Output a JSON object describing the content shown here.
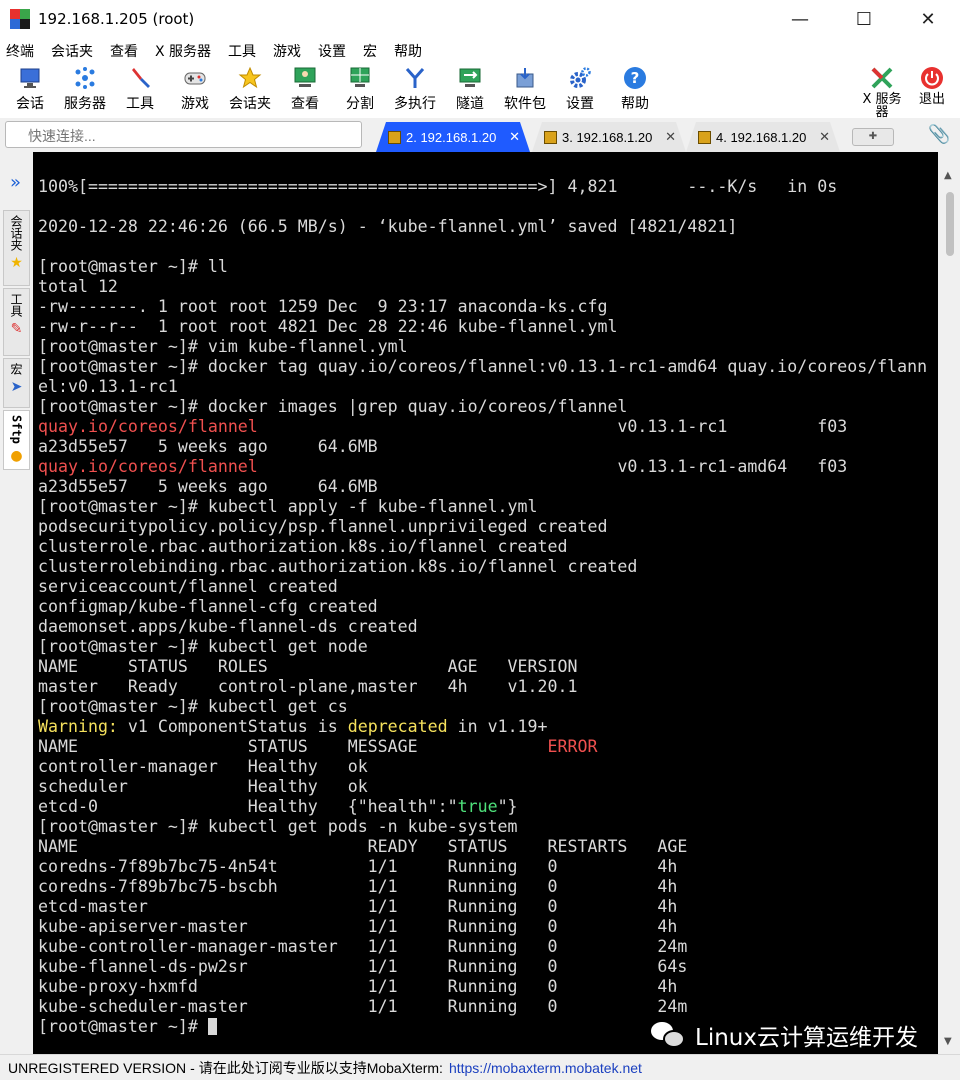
{
  "window": {
    "title": "192.168.1.205 (root)",
    "controls": {
      "minimize": "—",
      "maximize": "☐",
      "close": "✕"
    }
  },
  "menu": [
    "终端",
    "会话夹",
    "查看",
    "X 服务器",
    "工具",
    "游戏",
    "设置",
    "宏",
    "帮助"
  ],
  "toolbar": {
    "items": [
      {
        "label": "会话",
        "icon": "session-icon"
      },
      {
        "label": "服务器",
        "icon": "servers-icon"
      },
      {
        "label": "工具",
        "icon": "tools-icon"
      },
      {
        "label": "游戏",
        "icon": "games-icon"
      },
      {
        "label": "会话夹",
        "icon": "star-icon"
      },
      {
        "label": "查看",
        "icon": "view-icon"
      },
      {
        "label": "分割",
        "icon": "split-icon"
      },
      {
        "label": "多执行",
        "icon": "multiexec-icon"
      },
      {
        "label": "隧道",
        "icon": "tunnel-icon"
      },
      {
        "label": "软件包",
        "icon": "packages-icon"
      },
      {
        "label": "设置",
        "icon": "gear-icon"
      },
      {
        "label": "帮助",
        "icon": "help-icon"
      }
    ],
    "xserver_label": "X 服务器",
    "exit_label": "退出"
  },
  "quick_connect": {
    "placeholder": "快速连接..."
  },
  "tabs": [
    {
      "label": "2. 192.168.1.20",
      "active": true
    },
    {
      "label": "3. 192.168.1.20",
      "active": false
    },
    {
      "label": "4. 192.168.1.20",
      "active": false
    }
  ],
  "sidebar": {
    "tabs": [
      {
        "label": "会话夹",
        "icon": "star-icon"
      },
      {
        "label": "工具",
        "icon": "tools-icon"
      },
      {
        "label": "宏",
        "icon": "macro-icon"
      },
      {
        "label": "Sftp",
        "icon": "sftp-icon"
      }
    ]
  },
  "terminal": {
    "lines": [
      [
        {
          "t": "100%[=============================================>] 4,821       --.-K/s   in 0s"
        }
      ],
      [
        {
          "t": ""
        }
      ],
      [
        {
          "t": "2020-12-28 22:46:26 (66.5 MB/s) - ‘kube-flannel.yml’ saved [4821/4821]"
        }
      ],
      [
        {
          "t": ""
        }
      ],
      [
        {
          "t": "[root@master ~]# ll"
        }
      ],
      [
        {
          "t": "total 12"
        }
      ],
      [
        {
          "t": "-rw-------. 1 root root 1259 Dec  9 23:17 anaconda-ks.cfg"
        }
      ],
      [
        {
          "t": "-rw-r--r--  1 root root 4821 Dec 28 22:46 kube-flannel.yml"
        }
      ],
      [
        {
          "t": "[root@master ~]# vim kube-flannel.yml"
        }
      ],
      [
        {
          "t": "[root@master ~]# docker tag quay.io/coreos/flannel:v0.13.1-rc1-amd64 quay.io/coreos/flann"
        }
      ],
      [
        {
          "t": "el:v0.13.1-rc1"
        }
      ],
      [
        {
          "t": "[root@master ~]# docker images |grep quay.io/coreos/flannel"
        }
      ],
      [
        {
          "t": "quay.io/coreos/flannel",
          "c": "red"
        },
        {
          "t": "                                    v0.13.1-rc1         f03"
        }
      ],
      [
        {
          "t": "a23d55e57   5 weeks ago     64.6MB"
        }
      ],
      [
        {
          "t": "quay.io/coreos/flannel",
          "c": "red"
        },
        {
          "t": "                                    v0.13.1-rc1-amd64   f03"
        }
      ],
      [
        {
          "t": "a23d55e57   5 weeks ago     64.6MB"
        }
      ],
      [
        {
          "t": "[root@master ~]# kubectl apply -f kube-flannel.yml"
        }
      ],
      [
        {
          "t": "podsecuritypolicy.policy/psp.flannel.unprivileged created"
        }
      ],
      [
        {
          "t": "clusterrole.rbac.authorization.k8s.io/flannel created"
        }
      ],
      [
        {
          "t": "clusterrolebinding.rbac.authorization.k8s.io/flannel created"
        }
      ],
      [
        {
          "t": "serviceaccount/flannel created"
        }
      ],
      [
        {
          "t": "configmap/kube-flannel-cfg created"
        }
      ],
      [
        {
          "t": "daemonset.apps/kube-flannel-ds created"
        }
      ],
      [
        {
          "t": "[root@master ~]# kubectl get node"
        }
      ],
      [
        {
          "t": "NAME     STATUS   ROLES                  AGE   VERSION"
        }
      ],
      [
        {
          "t": "master   Ready    control-plane,master   4h    v1.20.1"
        }
      ],
      [
        {
          "t": "[root@master ~]# kubectl get cs"
        }
      ],
      [
        {
          "t": "Warning:",
          "c": "yellow"
        },
        {
          "t": " v1 ComponentStatus is "
        },
        {
          "t": "deprecated",
          "c": "yellow"
        },
        {
          "t": " in v1.19+"
        }
      ],
      [
        {
          "t": "NAME                 STATUS    MESSAGE             "
        },
        {
          "t": "ERROR",
          "c": "red"
        }
      ],
      [
        {
          "t": "controller-manager   Healthy   ok"
        }
      ],
      [
        {
          "t": "scheduler            Healthy   ok"
        }
      ],
      [
        {
          "t": "etcd-0               Healthy   {\"health\":\""
        },
        {
          "t": "true",
          "c": "green"
        },
        {
          "t": "\"}"
        }
      ],
      [
        {
          "t": "[root@master ~]# kubectl get pods -n kube-system"
        }
      ],
      [
        {
          "t": "NAME                             READY   STATUS    RESTARTS   AGE"
        }
      ],
      [
        {
          "t": "coredns-7f89b7bc75-4n54t         1/1     Running   0          4h"
        }
      ],
      [
        {
          "t": "coredns-7f89b7bc75-bscbh         1/1     Running   0          4h"
        }
      ],
      [
        {
          "t": "etcd-master                      1/1     Running   0          4h"
        }
      ],
      [
        {
          "t": "kube-apiserver-master            1/1     Running   0          4h"
        }
      ],
      [
        {
          "t": "kube-controller-manager-master   1/1     Running   0          24m"
        }
      ],
      [
        {
          "t": "kube-flannel-ds-pw2sr            1/1     Running   0          64s"
        }
      ],
      [
        {
          "t": "kube-proxy-hxmfd                 1/1     Running   0          4h"
        }
      ],
      [
        {
          "t": "kube-scheduler-master            1/1     Running   0          24m"
        }
      ],
      [
        {
          "t": "[root@master ~]# ",
          "cursor": true
        }
      ]
    ],
    "colors": {
      "red": "#f0504f",
      "yellow": "#f5e15c",
      "green": "#4ee07a",
      "fg": "#d9d9d9",
      "bg": "#000000"
    }
  },
  "watermark": {
    "text": "Linux云计算运维开发",
    "icon": "wechat-icon"
  },
  "status": {
    "unregistered": "UNREGISTERED VERSION",
    "message": " -  请在此处订阅专业版以支持MobaXterm:",
    "link": "https://mobaxterm.mobatek.net"
  }
}
